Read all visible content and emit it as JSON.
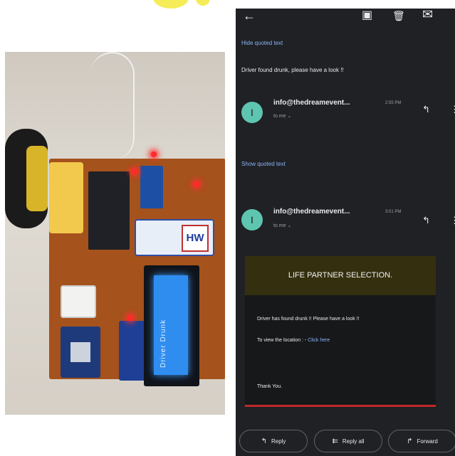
{
  "email": {
    "header_icons": {
      "back": "←",
      "archive": "▣",
      "delete": "🗑",
      "mail": "✉"
    },
    "hide_quoted_text_1": "Hide quoted text",
    "first_message_body": "Driver found drunk, please have a look !!",
    "messages": [
      {
        "avatar": "I",
        "sender": "info@thedreamevent...",
        "time": "2:55 PM",
        "to": "to me ⌄"
      },
      {
        "avatar": "I",
        "sender": "info@thedreamevent...",
        "time": "3:01 PM",
        "to": "to me ⌄"
      }
    ],
    "show_quoted_text": "Show quoted text",
    "card": {
      "title": "LIFE PARTNER SELECTION.",
      "line1": "Driver has found drunk !! Please have a look !!",
      "line2_prefix": "To view the location : - ",
      "line2_link": "Click here",
      "sign_off": "Thank You."
    },
    "buttons": {
      "reply": "Reply",
      "reply_all": "Reply all",
      "forward": "Forward"
    }
  },
  "hardware": {
    "lcd_text": "Driver Drunk",
    "battery_logo": "HW"
  },
  "colors": {
    "watermark": "#f3e93b",
    "avatar": "#5ec6b0",
    "link": "#8ab4f8",
    "card_header": "#34300f",
    "card_accent": "#c0292b"
  }
}
